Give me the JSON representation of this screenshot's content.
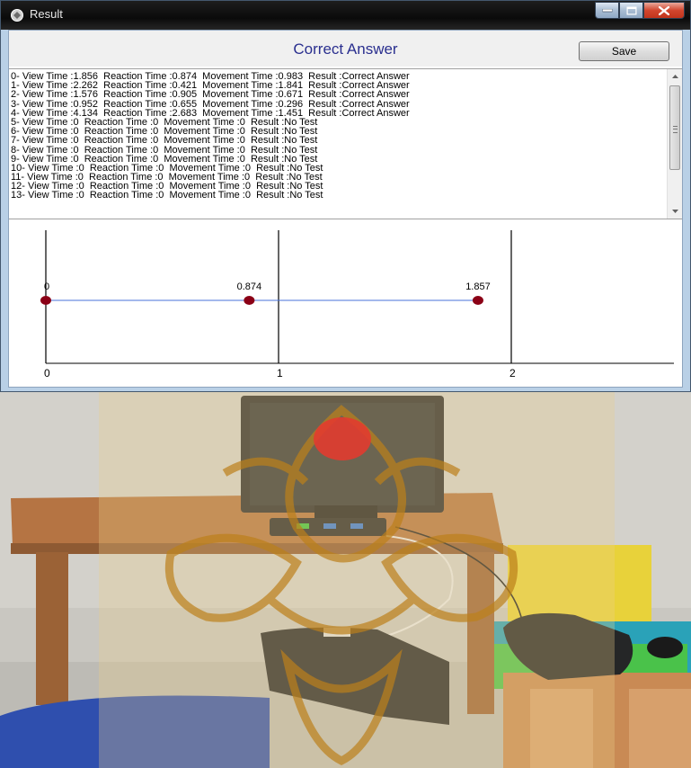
{
  "window": {
    "title": "Result",
    "heading": "Correct Answer",
    "save_label": "Save"
  },
  "results": [
    "0- View Time :1.856  Reaction Time :0.874  Movement Time :0.983  Result :Correct Answer",
    "1- View Time :2.262  Reaction Time :0.421  Movement Time :1.841  Result :Correct Answer",
    "2- View Time :1.576  Reaction Time :0.905  Movement Time :0.671  Result :Correct Answer",
    "3- View Time :0.952  Reaction Time :0.655  Movement Time :0.296  Result :Correct Answer",
    "4- View Time :4.134  Reaction Time :2.683  Movement Time :1.451  Result :Correct Answer",
    "5- View Time :0  Reaction Time :0  Movement Time :0  Result :No Test",
    "6- View Time :0  Reaction Time :0  Movement Time :0  Result :No Test",
    "7- View Time :0  Reaction Time :0  Movement Time :0  Result :No Test",
    "8- View Time :0  Reaction Time :0  Movement Time :0  Result :No Test",
    "9- View Time :0  Reaction Time :0  Movement Time :0  Result :No Test",
    "10- View Time :0  Reaction Time :0  Movement Time :0  Result :No Test",
    "11- View Time :0  Reaction Time :0  Movement Time :0  Result :No Test",
    "12- View Time :0  Reaction Time :0  Movement Time :0  Result :No Test",
    "13- View Time :0  Reaction Time :0  Movement Time :0  Result :No Test"
  ],
  "chart_data": {
    "type": "scatter",
    "x": [
      0,
      0.874,
      1.857
    ],
    "y": [
      0,
      0,
      0
    ],
    "point_labels": [
      "0",
      "0.874",
      "1.857"
    ],
    "x_ticks": [
      "0",
      "1",
      "2"
    ],
    "xlim": [
      0,
      2.75
    ],
    "grid": "vertical",
    "line_color": "#4a72d9",
    "marker_color": "#8b0016"
  },
  "colors": {
    "heading": "#2a2f8f",
    "watermark": "#d8a020",
    "watermark_dot": "#e23b2f"
  },
  "icons": {
    "app": "app-icon",
    "minimize": "minimize-icon",
    "maximize": "maximize-icon",
    "close": "close-icon"
  }
}
